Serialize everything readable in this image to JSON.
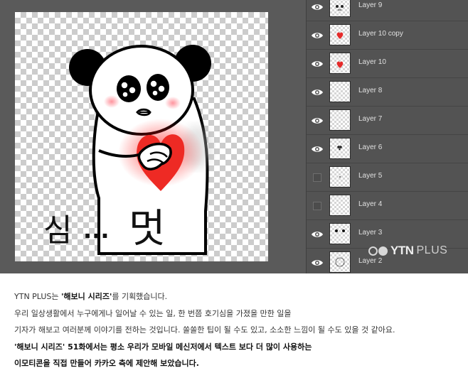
{
  "caption_text": {
    "pre": "심",
    "dots": "...",
    "post": "멋"
  },
  "layers": [
    {
      "name": "Layer 9",
      "visible": true,
      "thumb": "face-icon"
    },
    {
      "name": "Layer 10 copy",
      "visible": true,
      "thumb": "heart-icon"
    },
    {
      "name": "Layer 10",
      "visible": true,
      "thumb": "heart-icon"
    },
    {
      "name": "Layer 8",
      "visible": true,
      "thumb": "blank"
    },
    {
      "name": "Layer 7",
      "visible": true,
      "thumb": "blank"
    },
    {
      "name": "Layer 6",
      "visible": true,
      "thumb": "dots-icon"
    },
    {
      "name": "Layer 5",
      "visible": false,
      "thumb": "dot-icon"
    },
    {
      "name": "Layer 4",
      "visible": false,
      "thumb": "blank"
    },
    {
      "name": "Layer 3",
      "visible": true,
      "thumb": "eyes-icon"
    },
    {
      "name": "Layer 2",
      "visible": true,
      "thumb": "outline-icon"
    }
  ],
  "watermark": {
    "brand": "YTN",
    "suffix": "PLUS"
  },
  "article": {
    "line1": {
      "pre": "YTN PLUS는 ",
      "bold": "'해보니 시리즈'",
      "post": "를 기획했습니다."
    },
    "line2": "우리 일상생활에서 누구에게나 일어날 수 있는 일, 한 번쯤 호기심을 가졌을 만한 일을",
    "line3": "기자가 해보고 여러분께 이야기를 전하는 것입니다. 쏠쏠한 팁이 될 수도 있고, 소소한 느낌이 될 수도 있을 것 같아요.",
    "line4": "'해보니 시리즈' 51화에서는 평소 우리가 모바일 메신저에서 텍스트 보다 더 많이 사용하는",
    "line5": "이모티콘을 직접 만들어 카카오 측에 제안해 보았습니다."
  },
  "colors": {
    "panel": "#535353",
    "canvas_bg": "#5a5a5a",
    "heart": "#ee2a24",
    "cheek": "#ff9aa2"
  }
}
